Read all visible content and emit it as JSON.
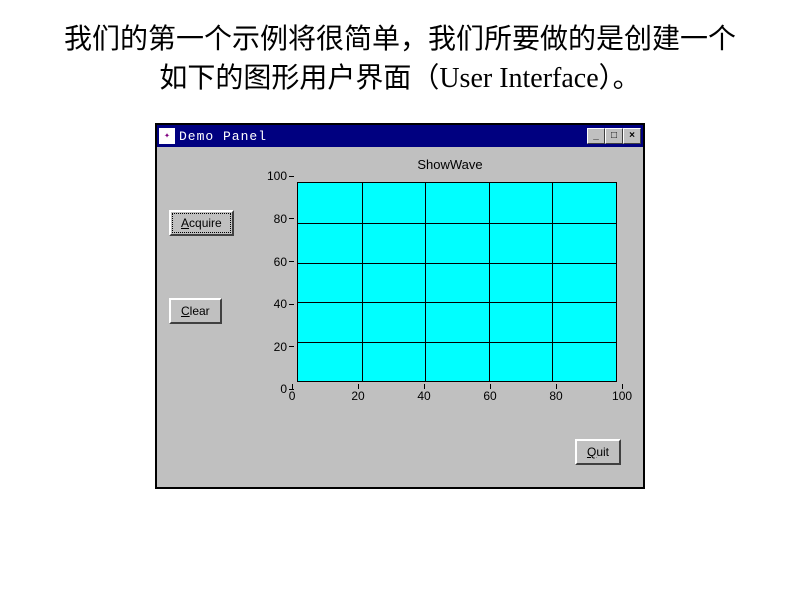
{
  "slide_text": "我们的第一个示例将很简单，我们所要做的是创建一个如下的图形用户界面（User Interface）。",
  "window": {
    "title": "Demo Panel",
    "controls": {
      "minimize": "_",
      "maximize": "□",
      "close": "×"
    }
  },
  "buttons": {
    "acquire": "Acquire",
    "clear": "Clear",
    "quit": "Quit"
  },
  "chart_data": {
    "type": "area",
    "title": "ShowWave",
    "xlabel": "",
    "ylabel": "",
    "xlim": [
      0,
      100
    ],
    "ylim": [
      0,
      100
    ],
    "x_ticks": [
      0,
      20,
      40,
      60,
      80,
      100
    ],
    "y_ticks": [
      0,
      20,
      40,
      60,
      80,
      100
    ],
    "series": []
  }
}
